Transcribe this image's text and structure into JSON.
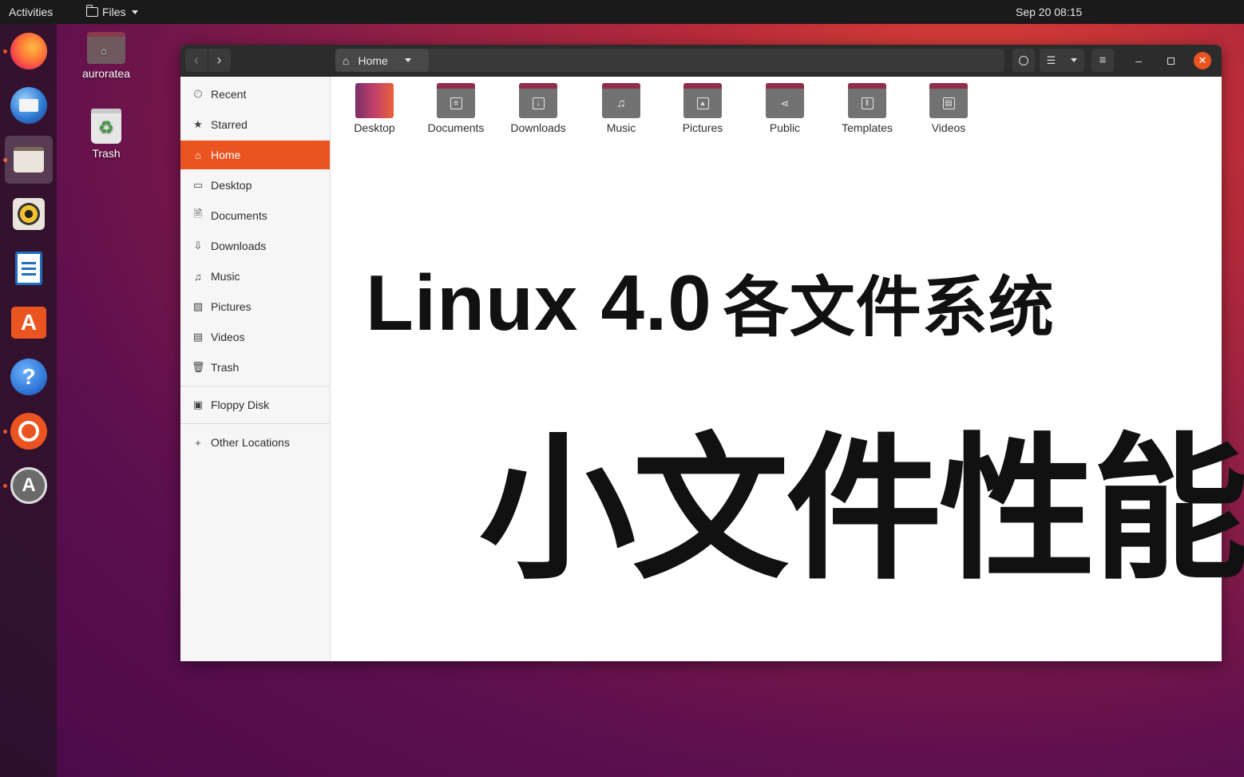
{
  "topbar": {
    "activities": "Activities",
    "app_menu": "Files",
    "clock": "Sep 20  08:15"
  },
  "dock": {
    "items": [
      {
        "name": "firefox-icon",
        "running": true
      },
      {
        "name": "thunderbird-icon",
        "running": false
      },
      {
        "name": "files-icon",
        "running": true,
        "active": true
      },
      {
        "name": "rhythmbox-icon",
        "running": false
      },
      {
        "name": "libreoffice-writer-icon",
        "running": false
      },
      {
        "name": "software-center-icon",
        "running": false
      },
      {
        "name": "help-icon",
        "running": false
      },
      {
        "name": "ubuntu-icon",
        "running": true
      },
      {
        "name": "software-updater-icon",
        "running": true
      }
    ]
  },
  "desktop": {
    "home_label": "auroratea",
    "trash_label": "Trash"
  },
  "window": {
    "path": "Home",
    "sidebar": {
      "places": [
        "Recent",
        "Starred",
        "Home",
        "Desktop",
        "Documents",
        "Downloads",
        "Music",
        "Pictures",
        "Videos",
        "Trash"
      ],
      "devices": [
        "Floppy Disk"
      ],
      "other": "Other Locations",
      "selected": "Home"
    },
    "folders": [
      "Desktop",
      "Documents",
      "Downloads",
      "Music",
      "Pictures",
      "Public",
      "Templates",
      "Videos"
    ]
  },
  "overlay": {
    "line1_latin": "Linux 4.0",
    "line1_cjk": "各文件系统",
    "line2": "小文件性能"
  },
  "colors": {
    "accent": "#e95420",
    "headerbar": "#2c2c2c",
    "topbar": "#1a1a1a"
  }
}
